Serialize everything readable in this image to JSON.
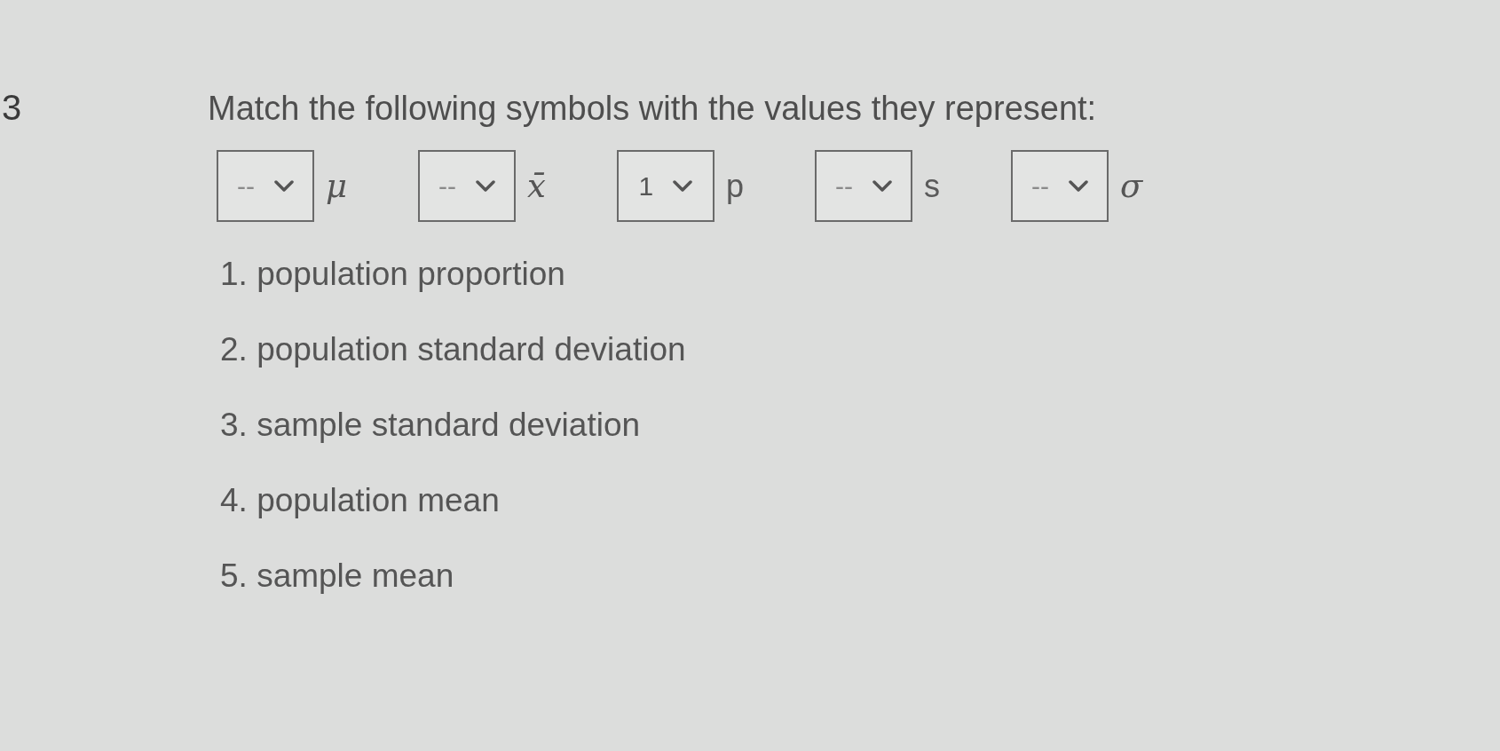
{
  "question_number": "3",
  "prompt": "Match the following symbols with the values they represent:",
  "matches": [
    {
      "value": "--",
      "symbol": "μ",
      "kind": "math"
    },
    {
      "value": "--",
      "symbol": "x̄",
      "kind": "math"
    },
    {
      "value": "1",
      "symbol": "p",
      "kind": "plain"
    },
    {
      "value": "--",
      "symbol": "s",
      "kind": "plain"
    },
    {
      "value": "--",
      "symbol": "σ",
      "kind": "math"
    }
  ],
  "options": [
    "1. population proportion",
    "2. population standard deviation",
    "3. sample standard deviation",
    "4. population mean",
    "5. sample mean"
  ]
}
